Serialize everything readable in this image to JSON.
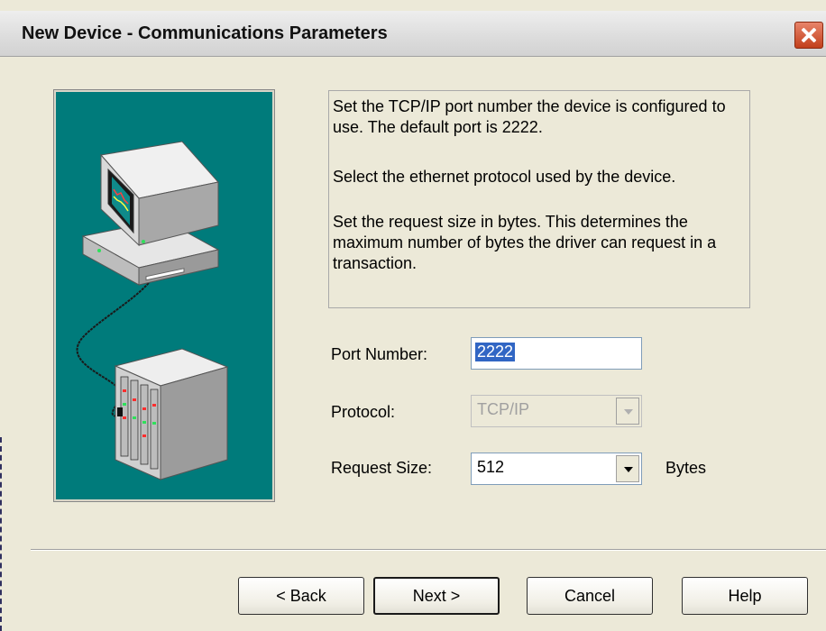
{
  "window": {
    "title": "New Device - Communications Parameters"
  },
  "info": {
    "paragraph1": "Set the TCP/IP port number the device is configured to use.  The  default port is 2222.",
    "paragraph2": "Select the ethernet protocol used by the device.",
    "paragraph3": "Set the request size in bytes.  This determines the maximum number of bytes the driver can request in a transaction."
  },
  "form": {
    "port_label": "Port Number:",
    "port_value": "2222",
    "protocol_label": "Protocol:",
    "protocol_value": "TCP/IP",
    "request_size_label": "Request Size:",
    "request_size_value": "512",
    "request_size_unit": "Bytes"
  },
  "buttons": {
    "back": "< Back",
    "next": "Next >",
    "cancel": "Cancel",
    "help": "Help"
  },
  "icons": {
    "close": "close-icon",
    "illustration": "computer-network-device-illustration"
  },
  "colors": {
    "illustration_bg": "#007b7b",
    "close_button": "#c2401c",
    "selection": "#3166c4"
  }
}
